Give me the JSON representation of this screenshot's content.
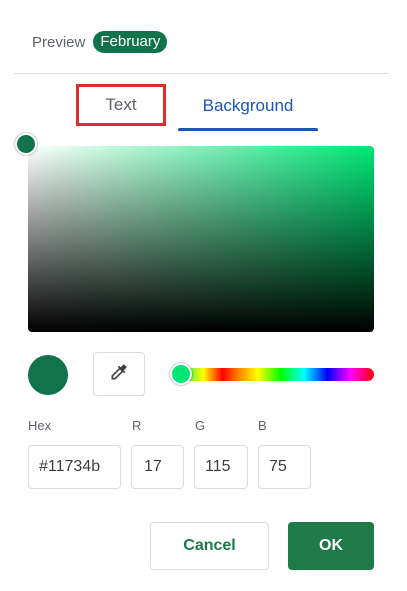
{
  "preview": {
    "label": "Preview",
    "chip_text": "February",
    "chip_color": "#11734b"
  },
  "tabs": [
    {
      "label": "Text",
      "highlighted": true
    },
    {
      "label": "Background",
      "selected": true
    }
  ],
  "picker": {
    "hue_color": "#00e676",
    "current_color": "#11734b"
  },
  "fields": {
    "hex": {
      "label": "Hex",
      "value": "#11734b"
    },
    "r": {
      "label": "R",
      "value": "17"
    },
    "g": {
      "label": "G",
      "value": "115"
    },
    "b": {
      "label": "B",
      "value": "75"
    }
  },
  "buttons": {
    "cancel": "Cancel",
    "ok": "OK"
  },
  "colors": {
    "accent_blue": "#1a56b8",
    "accent_green": "#1e7a47",
    "highlight_red": "#d93025"
  },
  "icons": {
    "eyedropper": "eyedropper-icon"
  }
}
